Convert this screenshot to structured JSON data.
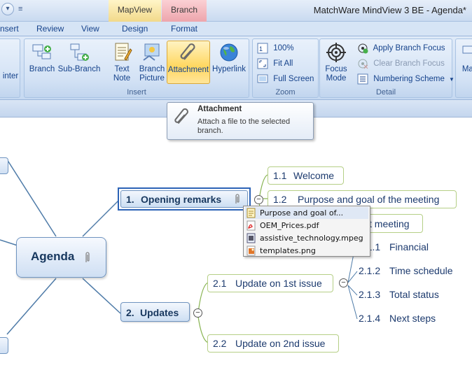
{
  "titlebar": {
    "app_title": "MatchWare MindView 3 BE - Agenda*",
    "context_tabs": [
      "MapView",
      "Branch"
    ]
  },
  "tabs": [
    "nsert",
    "Review",
    "View",
    "Design",
    "Format"
  ],
  "ribbon": {
    "insert_group": {
      "label": "Insert",
      "buttons": [
        "Branch",
        "Sub-Branch",
        "Text\nNote",
        "Branch\nPicture",
        "Attachment",
        "Hyperlink"
      ],
      "left_cut_label": "inter"
    },
    "zoom_group": {
      "label": "Zoom",
      "buttons": [
        "100%",
        "Fit All",
        "Full Screen"
      ]
    },
    "detail_group": {
      "label": "Detail",
      "focus_mode": "Focus\nMode",
      "buttons": [
        "Apply Branch Focus",
        "Clear Branch Focus",
        "Numbering Scheme"
      ],
      "right_cut_label": "Map"
    }
  },
  "tooltip": {
    "title": "Attachment",
    "body": "Attach a file to the selected branch."
  },
  "map": {
    "root": "Agenda",
    "branches": [
      {
        "num": "1.",
        "label": "Opening remarks"
      },
      {
        "num": "2.",
        "label": "Updates"
      }
    ],
    "subbranches": [
      {
        "num": "1.1",
        "label": "Welcome"
      },
      {
        "num": "1.2",
        "label": "Purpose and goal of the meeting"
      },
      {
        "num": "",
        "label": "st meeting"
      },
      {
        "num": "2.1",
        "label": "Update on 1st issue"
      },
      {
        "num": "2.2",
        "label": "Update on 2nd issue"
      },
      {
        "num": "2.1.1",
        "label": "Financial"
      },
      {
        "num": "2.1.2",
        "label": "Time schedule"
      },
      {
        "num": "2.1.3",
        "label": "Total status"
      },
      {
        "num": "2.1.4",
        "label": "Next steps"
      }
    ]
  },
  "attachments_popup": {
    "items": [
      "Purpose and goal of...",
      "OEM_Prices.pdf",
      "assistive_technology.mpeg",
      "templates.png"
    ]
  }
}
